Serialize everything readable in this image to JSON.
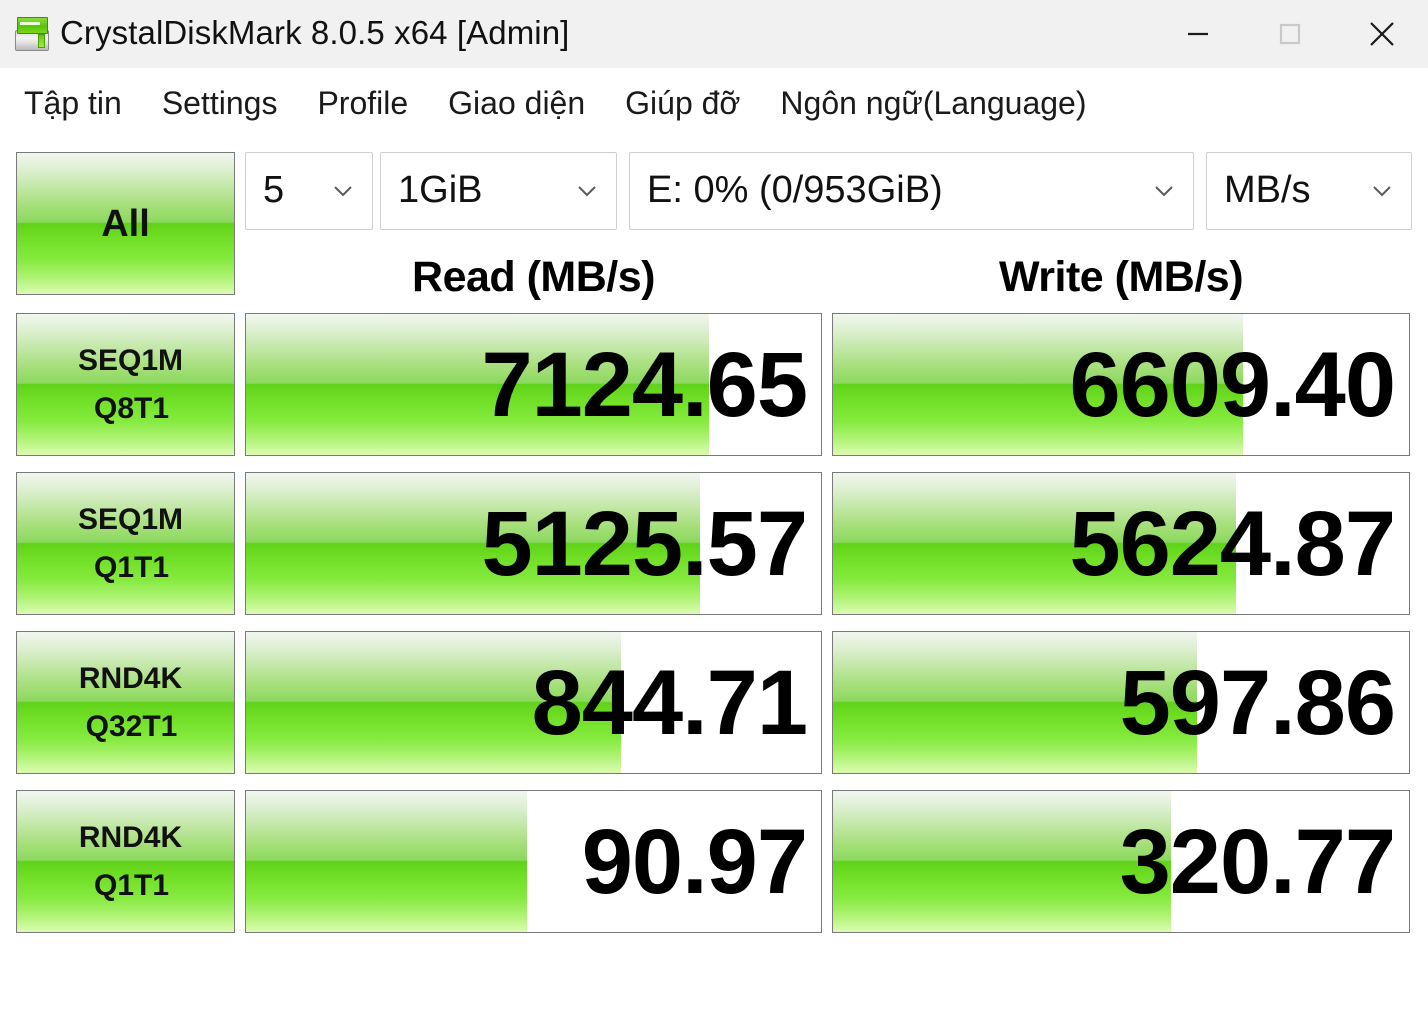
{
  "window": {
    "title": "CrystalDiskMark 8.0.5 x64 [Admin]",
    "icon": "crystaldiskmark-icon",
    "controls": {
      "minimize": "minimize-icon",
      "maximize": "maximize-icon",
      "close": "close-icon"
    }
  },
  "menubar": {
    "items": [
      {
        "label": "Tập tin"
      },
      {
        "label": "Settings"
      },
      {
        "label": "Profile"
      },
      {
        "label": "Giao diện"
      },
      {
        "label": "Giúp đỡ"
      },
      {
        "label": "Ngôn ngữ(Language)"
      }
    ]
  },
  "toolbar": {
    "all_button": "All",
    "runs": {
      "value": "5"
    },
    "size": {
      "value": "1GiB"
    },
    "drive": {
      "value": "E: 0% (0/953GiB)"
    },
    "unit": {
      "value": "MB/s"
    }
  },
  "headers": {
    "read": "Read (MB/s)",
    "write": "Write (MB/s)"
  },
  "colors": {
    "green_bright": "#5fd318",
    "green_mid": "#8cd95f",
    "green_light": "#ddfbb4",
    "titlebar_bg": "#f1f1f1",
    "border": "#7a7a7a"
  },
  "chart_data": {
    "type": "bar",
    "title": "CrystalDiskMark 8.0.5 benchmark results",
    "unit": "MB/s",
    "categories": [
      "SEQ1M Q8T1",
      "SEQ1M Q1T1",
      "RND4K Q32T1",
      "RND4K Q1T1"
    ],
    "series": [
      {
        "name": "Read (MB/s)",
        "values": [
          7124.65,
          5125.57,
          844.71,
          90.97
        ]
      },
      {
        "name": "Write (MB/s)",
        "values": [
          6609.4,
          5624.87,
          597.86,
          320.77
        ]
      }
    ],
    "bar_fill_percent": {
      "read": [
        80.6,
        78.9,
        65.3,
        48.9
      ],
      "write": [
        71.1,
        69.9,
        63.2,
        58.7
      ]
    }
  },
  "rows": [
    {
      "label_top": "SEQ1M",
      "label_bottom": "Q8T1",
      "read": {
        "value": "7124.65",
        "fill": "80.6%"
      },
      "write": {
        "value": "6609.40",
        "fill": "71.1%"
      }
    },
    {
      "label_top": "SEQ1M",
      "label_bottom": "Q1T1",
      "read": {
        "value": "5125.57",
        "fill": "78.9%"
      },
      "write": {
        "value": "5624.87",
        "fill": "69.9%"
      }
    },
    {
      "label_top": "RND4K",
      "label_bottom": "Q32T1",
      "read": {
        "value": "844.71",
        "fill": "65.3%"
      },
      "write": {
        "value": "597.86",
        "fill": "63.2%"
      }
    },
    {
      "label_top": "RND4K",
      "label_bottom": "Q1T1",
      "read": {
        "value": "90.97",
        "fill": "48.9%"
      },
      "write": {
        "value": "320.77",
        "fill": "58.7%"
      }
    }
  ]
}
